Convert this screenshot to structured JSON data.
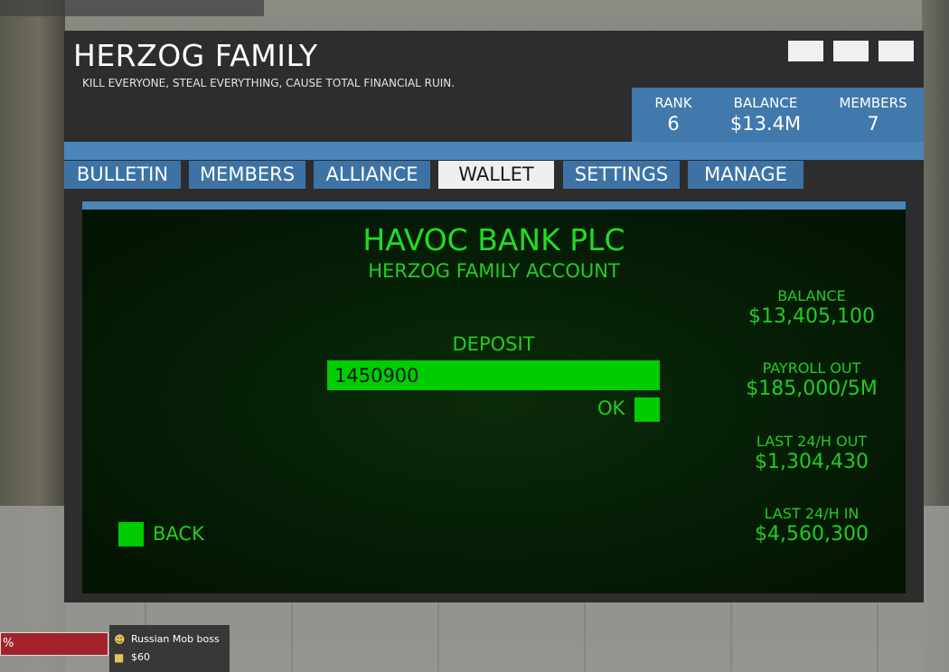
{
  "window": {
    "title": "HERZOG FAMILY",
    "subtitle": "KILL EVERYONE, STEAL EVERYTHING, CAUSE TOTAL FINANCIAL RUIN."
  },
  "stats": {
    "rank_label": "RANK",
    "rank_value": "6",
    "balance_label": "BALANCE",
    "balance_value": "$13.4M",
    "members_label": "MEMBERS",
    "members_value": "7"
  },
  "tabs": [
    {
      "label": "BULLETIN"
    },
    {
      "label": "MEMBERS"
    },
    {
      "label": "ALLIANCE"
    },
    {
      "label": "WALLET",
      "active": true
    },
    {
      "label": "SETTINGS"
    },
    {
      "label": "MANAGE"
    }
  ],
  "bank": {
    "name": "HAVOC BANK PLC",
    "account": "HERZOG FAMILY ACCOUNT",
    "deposit_label": "DEPOSIT",
    "deposit_value": "1450900",
    "ok_label": "OK",
    "back_label": "BACK"
  },
  "info": {
    "balance_label": "BALANCE",
    "balance_value": "$13,405,100",
    "payroll_label": "PAYROLL OUT",
    "payroll_value": "$185,000/5M",
    "out_label": "LAST 24/H OUT",
    "out_value": "$1,304,430",
    "in_label": "LAST 24/H IN",
    "in_value": "$4,560,300"
  },
  "hud": {
    "health_text": "%",
    "role": "Russian Mob boss",
    "cash": "$60"
  },
  "colors": {
    "accent_blue": "#4179ad",
    "terminal_green": "#22cc22",
    "button_green": "#00cc00"
  }
}
